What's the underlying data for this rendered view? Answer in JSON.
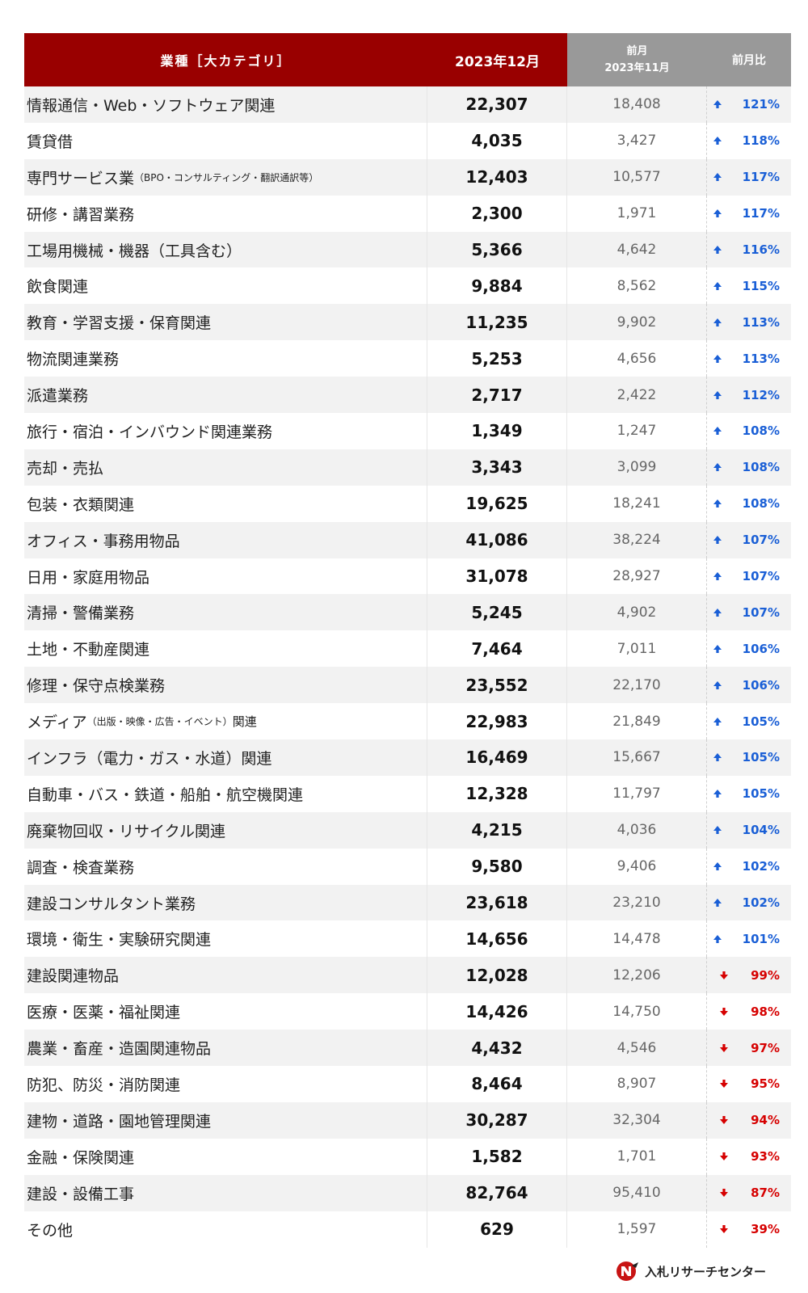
{
  "header": {
    "col_category": "業種［大カテゴリ］",
    "col_current": "2023年12月",
    "col_prev_label": "前月",
    "col_prev_month": "2023年11月",
    "col_ratio": "前月比"
  },
  "rows": [
    {
      "name": "情報通信・Web・ソフトウェア関連",
      "sub": "",
      "current": "22,307",
      "prev": "18,408",
      "ratio": "121%",
      "trend": "up"
    },
    {
      "name": "賃貸借",
      "sub": "",
      "current": "4,035",
      "prev": "3,427",
      "ratio": "118%",
      "trend": "up"
    },
    {
      "name": "専門サービス業",
      "sub": "（BPO・コンサルティング・翻訳通訳等）",
      "current": "12,403",
      "prev": "10,577",
      "ratio": "117%",
      "trend": "up"
    },
    {
      "name": "研修・講習業務",
      "sub": "",
      "current": "2,300",
      "prev": "1,971",
      "ratio": "117%",
      "trend": "up"
    },
    {
      "name": "工場用機械・機器（工具含む）",
      "sub": "",
      "current": "5,366",
      "prev": "4,642",
      "ratio": "116%",
      "trend": "up"
    },
    {
      "name": "飲食関連",
      "sub": "",
      "current": "9,884",
      "prev": "8,562",
      "ratio": "115%",
      "trend": "up"
    },
    {
      "name": "教育・学習支援・保育関連",
      "sub": "",
      "current": "11,235",
      "prev": "9,902",
      "ratio": "113%",
      "trend": "up"
    },
    {
      "name": "物流関連業務",
      "sub": "",
      "current": "5,253",
      "prev": "4,656",
      "ratio": "113%",
      "trend": "up"
    },
    {
      "name": "派遣業務",
      "sub": "",
      "current": "2,717",
      "prev": "2,422",
      "ratio": "112%",
      "trend": "up"
    },
    {
      "name": "旅行・宿泊・インバウンド関連業務",
      "sub": "",
      "current": "1,349",
      "prev": "1,247",
      "ratio": "108%",
      "trend": "up"
    },
    {
      "name": "売却・売払",
      "sub": "",
      "current": "3,343",
      "prev": "3,099",
      "ratio": "108%",
      "trend": "up"
    },
    {
      "name": "包装・衣類関連",
      "sub": "",
      "current": "19,625",
      "prev": "18,241",
      "ratio": "108%",
      "trend": "up"
    },
    {
      "name": "オフィス・事務用物品",
      "sub": "",
      "current": "41,086",
      "prev": "38,224",
      "ratio": "107%",
      "trend": "up"
    },
    {
      "name": "日用・家庭用物品",
      "sub": "",
      "current": "31,078",
      "prev": "28,927",
      "ratio": "107%",
      "trend": "up"
    },
    {
      "name": "清掃・警備業務",
      "sub": "",
      "current": "5,245",
      "prev": "4,902",
      "ratio": "107%",
      "trend": "up"
    },
    {
      "name": "土地・不動産関連",
      "sub": "",
      "current": "7,464",
      "prev": "7,011",
      "ratio": "106%",
      "trend": "up"
    },
    {
      "name": "修理・保守点検業務",
      "sub": "",
      "current": "23,552",
      "prev": "22,170",
      "ratio": "106%",
      "trend": "up"
    },
    {
      "name": "メディア",
      "sub": "（出版・映像・広告・イベント）関連",
      "current": "22,983",
      "prev": "21,849",
      "ratio": "105%",
      "trend": "up"
    },
    {
      "name": "インフラ（電力・ガス・水道）関連",
      "sub": "",
      "current": "16,469",
      "prev": "15,667",
      "ratio": "105%",
      "trend": "up"
    },
    {
      "name": "自動車・バス・鉄道・船舶・航空機関連",
      "sub": "",
      "current": "12,328",
      "prev": "11,797",
      "ratio": "105%",
      "trend": "up"
    },
    {
      "name": "廃棄物回収・リサイクル関連",
      "sub": "",
      "current": "4,215",
      "prev": "4,036",
      "ratio": "104%",
      "trend": "up"
    },
    {
      "name": "調査・検査業務",
      "sub": "",
      "current": "9,580",
      "prev": "9,406",
      "ratio": "102%",
      "trend": "up"
    },
    {
      "name": "建設コンサルタント業務",
      "sub": "",
      "current": "23,618",
      "prev": "23,210",
      "ratio": "102%",
      "trend": "up"
    },
    {
      "name": "環境・衛生・実験研究関連",
      "sub": "",
      "current": "14,656",
      "prev": "14,478",
      "ratio": "101%",
      "trend": "up"
    },
    {
      "name": "建設関連物品",
      "sub": "",
      "current": "12,028",
      "prev": "12,206",
      "ratio": "99%",
      "trend": "down"
    },
    {
      "name": "医療・医薬・福祉関連",
      "sub": "",
      "current": "14,426",
      "prev": "14,750",
      "ratio": "98%",
      "trend": "down"
    },
    {
      "name": "農業・畜産・造園関連物品",
      "sub": "",
      "current": "4,432",
      "prev": "4,546",
      "ratio": "97%",
      "trend": "down"
    },
    {
      "name": "防犯、防災・消防関連",
      "sub": "",
      "current": "8,464",
      "prev": "8,907",
      "ratio": "95%",
      "trend": "down"
    },
    {
      "name": "建物・道路・園地管理関連",
      "sub": "",
      "current": "30,287",
      "prev": "32,304",
      "ratio": "94%",
      "trend": "down"
    },
    {
      "name": "金融・保険関連",
      "sub": "",
      "current": "1,582",
      "prev": "1,701",
      "ratio": "93%",
      "trend": "down"
    },
    {
      "name": "建設・設備工事",
      "sub": "",
      "current": "82,764",
      "prev": "95,410",
      "ratio": "87%",
      "trend": "down"
    },
    {
      "name": "その他",
      "sub": "",
      "current": "629",
      "prev": "1,597",
      "ratio": "39%",
      "trend": "down"
    }
  ],
  "colors": {
    "header_red": "#990000",
    "header_gray": "#999999",
    "up": "#1a5fd6",
    "down": "#d60000"
  },
  "icons": {
    "up": "arrow-up-icon",
    "down": "arrow-down-icon",
    "logo": "logo-mark-icon"
  },
  "footer": {
    "brand": "入札リサーチセンター"
  }
}
